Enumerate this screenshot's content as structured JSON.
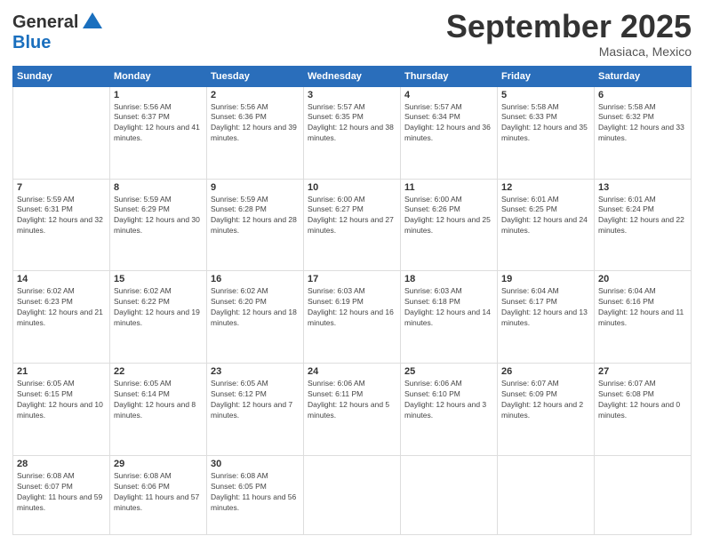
{
  "header": {
    "logo_general": "General",
    "logo_blue": "Blue",
    "month_title": "September 2025",
    "location": "Masiaca, Mexico"
  },
  "weekdays": [
    "Sunday",
    "Monday",
    "Tuesday",
    "Wednesday",
    "Thursday",
    "Friday",
    "Saturday"
  ],
  "weeks": [
    [
      {
        "day": "",
        "sunrise": "",
        "sunset": "",
        "daylight": ""
      },
      {
        "day": "1",
        "sunrise": "Sunrise: 5:56 AM",
        "sunset": "Sunset: 6:37 PM",
        "daylight": "Daylight: 12 hours and 41 minutes."
      },
      {
        "day": "2",
        "sunrise": "Sunrise: 5:56 AM",
        "sunset": "Sunset: 6:36 PM",
        "daylight": "Daylight: 12 hours and 39 minutes."
      },
      {
        "day": "3",
        "sunrise": "Sunrise: 5:57 AM",
        "sunset": "Sunset: 6:35 PM",
        "daylight": "Daylight: 12 hours and 38 minutes."
      },
      {
        "day": "4",
        "sunrise": "Sunrise: 5:57 AM",
        "sunset": "Sunset: 6:34 PM",
        "daylight": "Daylight: 12 hours and 36 minutes."
      },
      {
        "day": "5",
        "sunrise": "Sunrise: 5:58 AM",
        "sunset": "Sunset: 6:33 PM",
        "daylight": "Daylight: 12 hours and 35 minutes."
      },
      {
        "day": "6",
        "sunrise": "Sunrise: 5:58 AM",
        "sunset": "Sunset: 6:32 PM",
        "daylight": "Daylight: 12 hours and 33 minutes."
      }
    ],
    [
      {
        "day": "7",
        "sunrise": "Sunrise: 5:59 AM",
        "sunset": "Sunset: 6:31 PM",
        "daylight": "Daylight: 12 hours and 32 minutes."
      },
      {
        "day": "8",
        "sunrise": "Sunrise: 5:59 AM",
        "sunset": "Sunset: 6:29 PM",
        "daylight": "Daylight: 12 hours and 30 minutes."
      },
      {
        "day": "9",
        "sunrise": "Sunrise: 5:59 AM",
        "sunset": "Sunset: 6:28 PM",
        "daylight": "Daylight: 12 hours and 28 minutes."
      },
      {
        "day": "10",
        "sunrise": "Sunrise: 6:00 AM",
        "sunset": "Sunset: 6:27 PM",
        "daylight": "Daylight: 12 hours and 27 minutes."
      },
      {
        "day": "11",
        "sunrise": "Sunrise: 6:00 AM",
        "sunset": "Sunset: 6:26 PM",
        "daylight": "Daylight: 12 hours and 25 minutes."
      },
      {
        "day": "12",
        "sunrise": "Sunrise: 6:01 AM",
        "sunset": "Sunset: 6:25 PM",
        "daylight": "Daylight: 12 hours and 24 minutes."
      },
      {
        "day": "13",
        "sunrise": "Sunrise: 6:01 AM",
        "sunset": "Sunset: 6:24 PM",
        "daylight": "Daylight: 12 hours and 22 minutes."
      }
    ],
    [
      {
        "day": "14",
        "sunrise": "Sunrise: 6:02 AM",
        "sunset": "Sunset: 6:23 PM",
        "daylight": "Daylight: 12 hours and 21 minutes."
      },
      {
        "day": "15",
        "sunrise": "Sunrise: 6:02 AM",
        "sunset": "Sunset: 6:22 PM",
        "daylight": "Daylight: 12 hours and 19 minutes."
      },
      {
        "day": "16",
        "sunrise": "Sunrise: 6:02 AM",
        "sunset": "Sunset: 6:20 PM",
        "daylight": "Daylight: 12 hours and 18 minutes."
      },
      {
        "day": "17",
        "sunrise": "Sunrise: 6:03 AM",
        "sunset": "Sunset: 6:19 PM",
        "daylight": "Daylight: 12 hours and 16 minutes."
      },
      {
        "day": "18",
        "sunrise": "Sunrise: 6:03 AM",
        "sunset": "Sunset: 6:18 PM",
        "daylight": "Daylight: 12 hours and 14 minutes."
      },
      {
        "day": "19",
        "sunrise": "Sunrise: 6:04 AM",
        "sunset": "Sunset: 6:17 PM",
        "daylight": "Daylight: 12 hours and 13 minutes."
      },
      {
        "day": "20",
        "sunrise": "Sunrise: 6:04 AM",
        "sunset": "Sunset: 6:16 PM",
        "daylight": "Daylight: 12 hours and 11 minutes."
      }
    ],
    [
      {
        "day": "21",
        "sunrise": "Sunrise: 6:05 AM",
        "sunset": "Sunset: 6:15 PM",
        "daylight": "Daylight: 12 hours and 10 minutes."
      },
      {
        "day": "22",
        "sunrise": "Sunrise: 6:05 AM",
        "sunset": "Sunset: 6:14 PM",
        "daylight": "Daylight: 12 hours and 8 minutes."
      },
      {
        "day": "23",
        "sunrise": "Sunrise: 6:05 AM",
        "sunset": "Sunset: 6:12 PM",
        "daylight": "Daylight: 12 hours and 7 minutes."
      },
      {
        "day": "24",
        "sunrise": "Sunrise: 6:06 AM",
        "sunset": "Sunset: 6:11 PM",
        "daylight": "Daylight: 12 hours and 5 minutes."
      },
      {
        "day": "25",
        "sunrise": "Sunrise: 6:06 AM",
        "sunset": "Sunset: 6:10 PM",
        "daylight": "Daylight: 12 hours and 3 minutes."
      },
      {
        "day": "26",
        "sunrise": "Sunrise: 6:07 AM",
        "sunset": "Sunset: 6:09 PM",
        "daylight": "Daylight: 12 hours and 2 minutes."
      },
      {
        "day": "27",
        "sunrise": "Sunrise: 6:07 AM",
        "sunset": "Sunset: 6:08 PM",
        "daylight": "Daylight: 12 hours and 0 minutes."
      }
    ],
    [
      {
        "day": "28",
        "sunrise": "Sunrise: 6:08 AM",
        "sunset": "Sunset: 6:07 PM",
        "daylight": "Daylight: 11 hours and 59 minutes."
      },
      {
        "day": "29",
        "sunrise": "Sunrise: 6:08 AM",
        "sunset": "Sunset: 6:06 PM",
        "daylight": "Daylight: 11 hours and 57 minutes."
      },
      {
        "day": "30",
        "sunrise": "Sunrise: 6:08 AM",
        "sunset": "Sunset: 6:05 PM",
        "daylight": "Daylight: 11 hours and 56 minutes."
      },
      {
        "day": "",
        "sunrise": "",
        "sunset": "",
        "daylight": ""
      },
      {
        "day": "",
        "sunrise": "",
        "sunset": "",
        "daylight": ""
      },
      {
        "day": "",
        "sunrise": "",
        "sunset": "",
        "daylight": ""
      },
      {
        "day": "",
        "sunrise": "",
        "sunset": "",
        "daylight": ""
      }
    ]
  ]
}
